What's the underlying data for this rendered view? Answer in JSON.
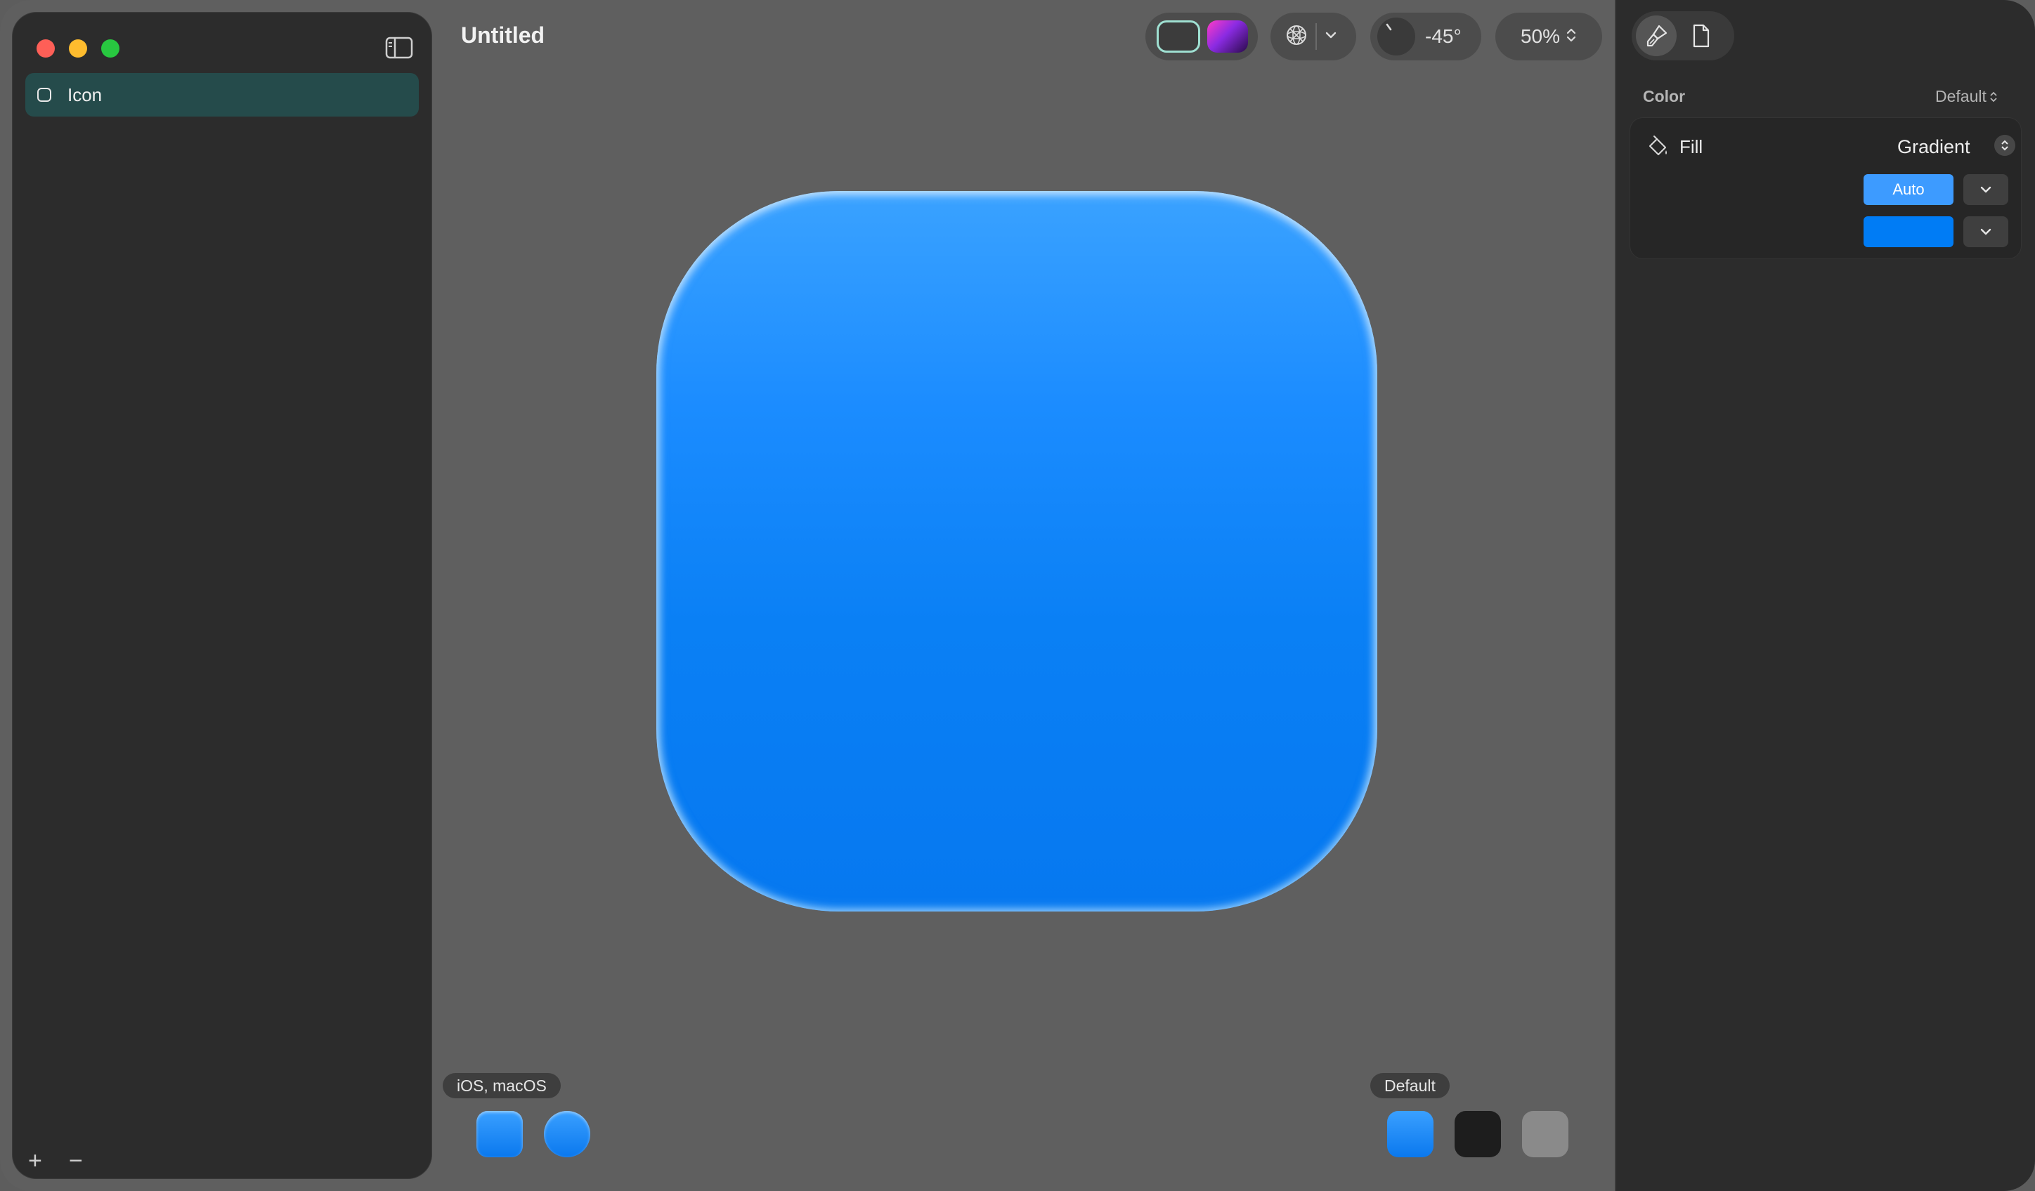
{
  "window": {
    "title": "Untitled"
  },
  "sidebar": {
    "items": [
      {
        "label": "Icon",
        "icon": "square-icon",
        "selected": true
      }
    ],
    "add_label": "+",
    "remove_label": "−"
  },
  "toolbar": {
    "appearance_modes": [
      "default",
      "dark"
    ],
    "light_angle": "-45°",
    "zoom": "50%"
  },
  "canvas": {
    "icon_color_top": "#3aa2ff",
    "icon_color_bottom": "#0678f0"
  },
  "bottom": {
    "platform_label": "iOS, macOS",
    "variant_label": "Default"
  },
  "inspector": {
    "tabs": [
      "paintbrush-icon",
      "document-icon"
    ],
    "section_label": "Color",
    "section_value": "Default",
    "fill_label": "Fill",
    "fill_mode": "Gradient",
    "auto_label": "Auto",
    "swatch_color": "#007cf5"
  },
  "colors": {
    "accent": "#3d9bff",
    "sidebar_selected": "#254b4b",
    "close": "#fe5f57",
    "minimize": "#febc2e",
    "maximize": "#28c840"
  }
}
